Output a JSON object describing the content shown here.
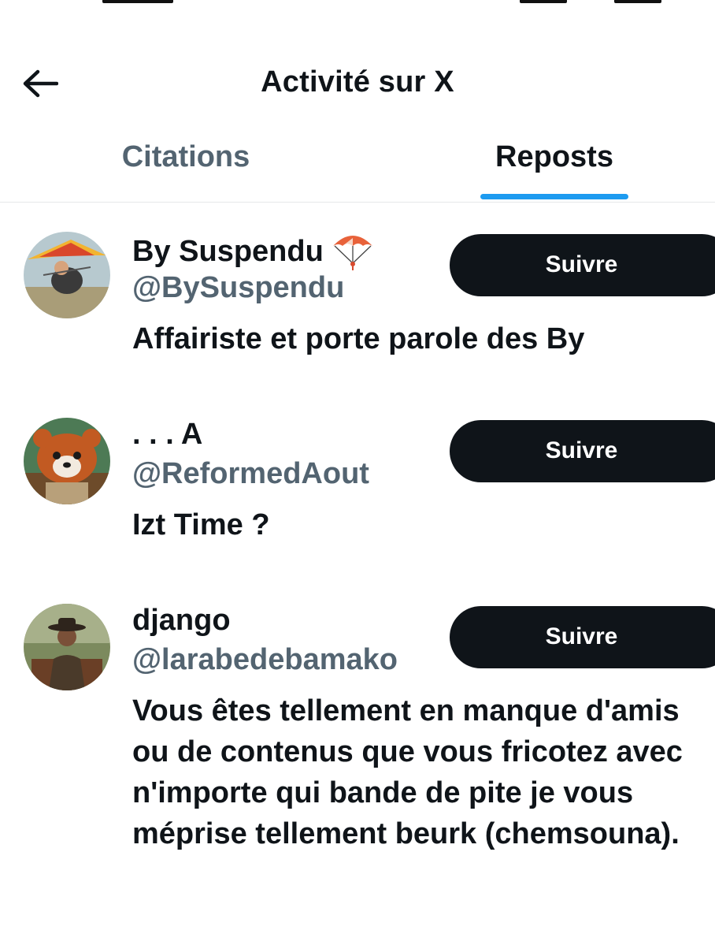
{
  "header": {
    "title": "Activité sur X",
    "back_icon": "arrow-left-icon"
  },
  "tabs": [
    {
      "label": "Citations",
      "active": false
    },
    {
      "label": "Reposts",
      "active": true
    }
  ],
  "colors": {
    "accent": "#1d9bf0",
    "text": "#0f1419",
    "muted": "#536471",
    "button": "#0f1419"
  },
  "users": [
    {
      "name": "By Suspendu",
      "name_icon": "parachute-emoji",
      "handle": "@BySuspendu",
      "bio": "Affairiste et porte parole des By",
      "follow_label": "Suivre"
    },
    {
      "name": ". . . A",
      "handle": "@ReformedAout",
      "bio": "Izt Time ?",
      "follow_label": "Suivre"
    },
    {
      "name": "django",
      "handle": "@larabedebamako",
      "bio": "Vous êtes tellement en manque d'amis ou de contenus que vous fricotez avec n'importe qui bande de pite je vous méprise tellement beurk (chemsouna).",
      "follow_label": "Suivre"
    }
  ]
}
